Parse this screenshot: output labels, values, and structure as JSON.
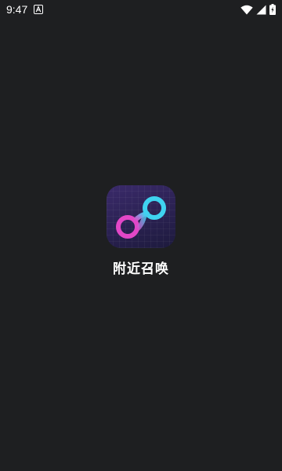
{
  "status_bar": {
    "time": "9:47",
    "left_icons": [
      "notification-a-icon"
    ],
    "right_icons": [
      "wifi-icon",
      "cellular-signal-icon",
      "battery-charging-icon"
    ]
  },
  "splash": {
    "app_icon": "infinity-logo-icon",
    "app_name": "附近召唤",
    "colors": {
      "background": "#1e1f21",
      "icon_bg": "#2d2454",
      "loop_pink": "#e247c7",
      "loop_cyan": "#3fd3f0"
    }
  }
}
